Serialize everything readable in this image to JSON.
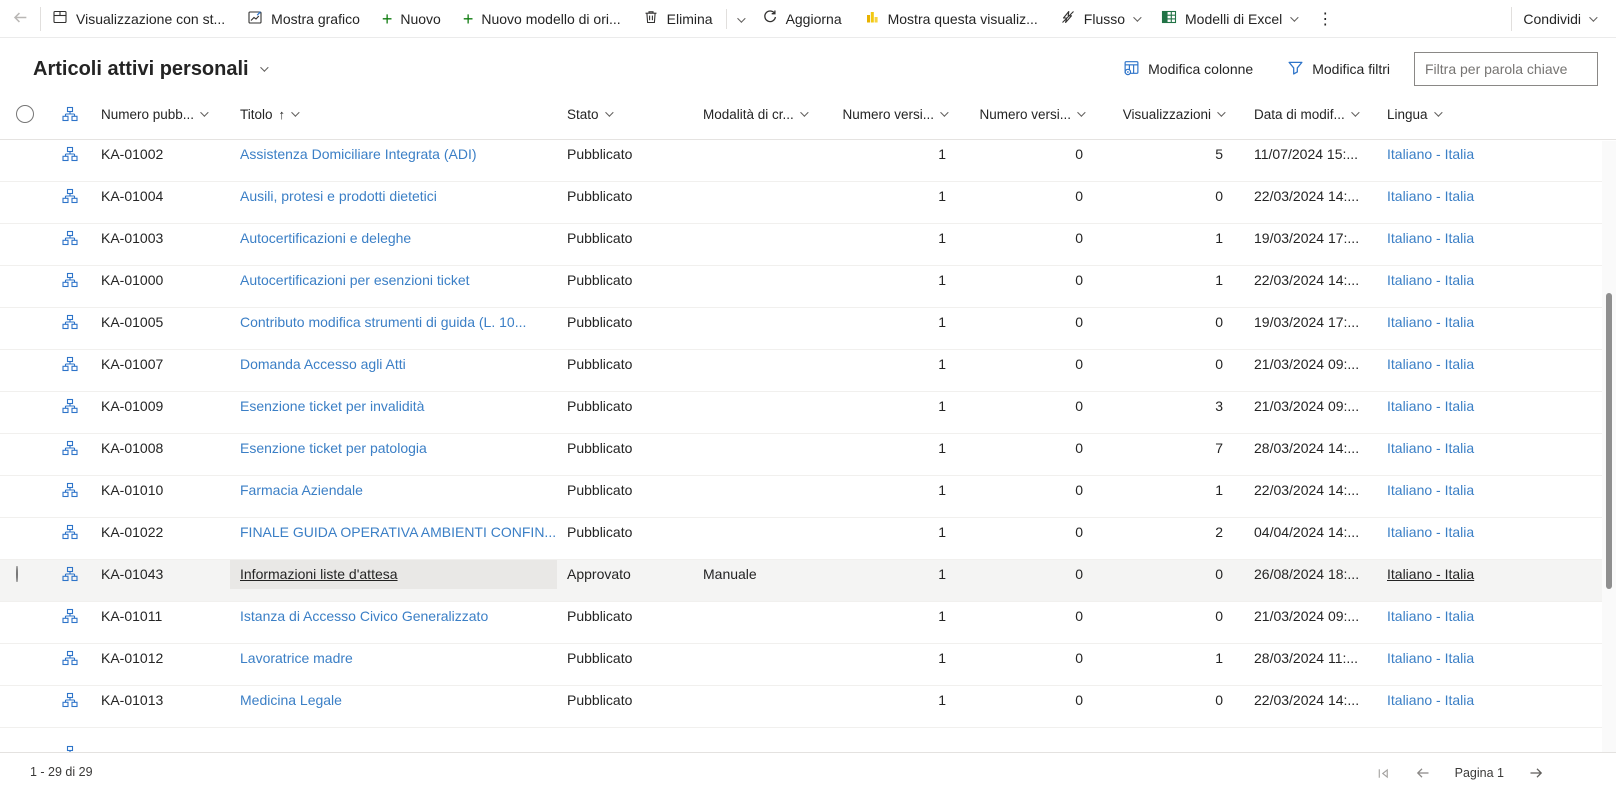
{
  "colors": {
    "link_blue": "#3b7fc6",
    "icon_blue": "#2e74c9",
    "plus_green": "#107c10",
    "excel_green": "#217346",
    "powerbi_yellow": "#f2c811",
    "selected_row_bg": "#f4f4f3"
  },
  "command_bar": {
    "items": {
      "switch_view": "Visualizzazione con st...",
      "show_chart": "Mostra grafico",
      "new": "Nuovo",
      "new_template": "Nuovo modello di ori...",
      "delete": "Elimina",
      "refresh": "Aggiorna",
      "show_visualization": "Mostra questa visualiz...",
      "flow": "Flusso",
      "excel_templates": "Modelli di Excel",
      "overflow": "⋮",
      "share": "Condividi"
    }
  },
  "view_header": {
    "title": "Articoli attivi personali",
    "edit_columns": "Modifica colonne",
    "edit_filters": "Modifica filtri",
    "search_placeholder": "Filtra per parola chiave"
  },
  "grid": {
    "columns": [
      {
        "label": "Numero pubb..."
      },
      {
        "label": "Titolo",
        "sort": "asc"
      },
      {
        "label": "Stato"
      },
      {
        "label": "Modalità di cr..."
      },
      {
        "label": "Numero versi...",
        "align": "right"
      },
      {
        "label": "Numero versi...",
        "align": "right"
      },
      {
        "label": "Visualizzazioni",
        "align": "right"
      },
      {
        "label": "Data di modif..."
      },
      {
        "label": "Lingua"
      }
    ],
    "rows": [
      {
        "number": "KA-01002",
        "title": "Assistenza Domiciliare Integrata (ADI)",
        "stato": "Pubblicato",
        "modalita": "",
        "ver1": "1",
        "ver2": "0",
        "views": "5",
        "modified": "11/07/2024 15:...",
        "lingua": "Italiano - Italia",
        "selected": false
      },
      {
        "number": "KA-01004",
        "title": "Ausili, protesi e prodotti dietetici",
        "stato": "Pubblicato",
        "modalita": "",
        "ver1": "1",
        "ver2": "0",
        "views": "0",
        "modified": "22/03/2024 14:...",
        "lingua": "Italiano - Italia",
        "selected": false
      },
      {
        "number": "KA-01003",
        "title": "Autocertificazioni e deleghe",
        "stato": "Pubblicato",
        "modalita": "",
        "ver1": "1",
        "ver2": "0",
        "views": "1",
        "modified": "19/03/2024 17:...",
        "lingua": "Italiano - Italia",
        "selected": false
      },
      {
        "number": "KA-01000",
        "title": "Autocertificazioni per esenzioni ticket",
        "stato": "Pubblicato",
        "modalita": "",
        "ver1": "1",
        "ver2": "0",
        "views": "1",
        "modified": "22/03/2024 14:...",
        "lingua": "Italiano - Italia",
        "selected": false
      },
      {
        "number": "KA-01005",
        "title": "Contributo modifica strumenti di guida (L. 10...",
        "stato": "Pubblicato",
        "modalita": "",
        "ver1": "1",
        "ver2": "0",
        "views": "0",
        "modified": "19/03/2024 17:...",
        "lingua": "Italiano - Italia",
        "selected": false
      },
      {
        "number": "KA-01007",
        "title": "Domanda Accesso agli Atti",
        "stato": "Pubblicato",
        "modalita": "",
        "ver1": "1",
        "ver2": "0",
        "views": "0",
        "modified": "21/03/2024 09:...",
        "lingua": "Italiano - Italia",
        "selected": false
      },
      {
        "number": "KA-01009",
        "title": "Esenzione ticket per invalidità",
        "stato": "Pubblicato",
        "modalita": "",
        "ver1": "1",
        "ver2": "0",
        "views": "3",
        "modified": "21/03/2024 09:...",
        "lingua": "Italiano - Italia",
        "selected": false
      },
      {
        "number": "KA-01008",
        "title": "Esenzione ticket per patologia",
        "stato": "Pubblicato",
        "modalita": "",
        "ver1": "1",
        "ver2": "0",
        "views": "7",
        "modified": "28/03/2024 14:...",
        "lingua": "Italiano - Italia",
        "selected": false
      },
      {
        "number": "KA-01010",
        "title": "Farmacia Aziendale",
        "stato": "Pubblicato",
        "modalita": "",
        "ver1": "1",
        "ver2": "0",
        "views": "1",
        "modified": "22/03/2024 14:...",
        "lingua": "Italiano - Italia",
        "selected": false
      },
      {
        "number": "KA-01022",
        "title": "FINALE GUIDA OPERATIVA AMBIENTI CONFIN...",
        "stato": "Pubblicato",
        "modalita": "",
        "ver1": "1",
        "ver2": "0",
        "views": "2",
        "modified": "04/04/2024 14:...",
        "lingua": "Italiano - Italia",
        "selected": false
      },
      {
        "number": "KA-01043",
        "title": "Informazioni liste d'attesa",
        "stato": "Approvato",
        "modalita": "Manuale",
        "ver1": "1",
        "ver2": "0",
        "views": "0",
        "modified": "26/08/2024 18:...",
        "lingua": "Italiano - Italia",
        "selected": true
      },
      {
        "number": "KA-01011",
        "title": "Istanza di Accesso Civico Generalizzato",
        "stato": "Pubblicato",
        "modalita": "",
        "ver1": "1",
        "ver2": "0",
        "views": "0",
        "modified": "21/03/2024 09:...",
        "lingua": "Italiano - Italia",
        "selected": false
      },
      {
        "number": "KA-01012",
        "title": "Lavoratrice madre",
        "stato": "Pubblicato",
        "modalita": "",
        "ver1": "1",
        "ver2": "0",
        "views": "1",
        "modified": "28/03/2024 11:...",
        "lingua": "Italiano - Italia",
        "selected": false
      },
      {
        "number": "KA-01013",
        "title": "Medicina Legale",
        "stato": "Pubblicato",
        "modalita": "",
        "ver1": "1",
        "ver2": "0",
        "views": "0",
        "modified": "22/03/2024 14:...",
        "lingua": "Italiano - Italia",
        "selected": false
      }
    ]
  },
  "footer": {
    "record_range": "1 - 29 di 29",
    "page_label": "Pagina 1"
  }
}
